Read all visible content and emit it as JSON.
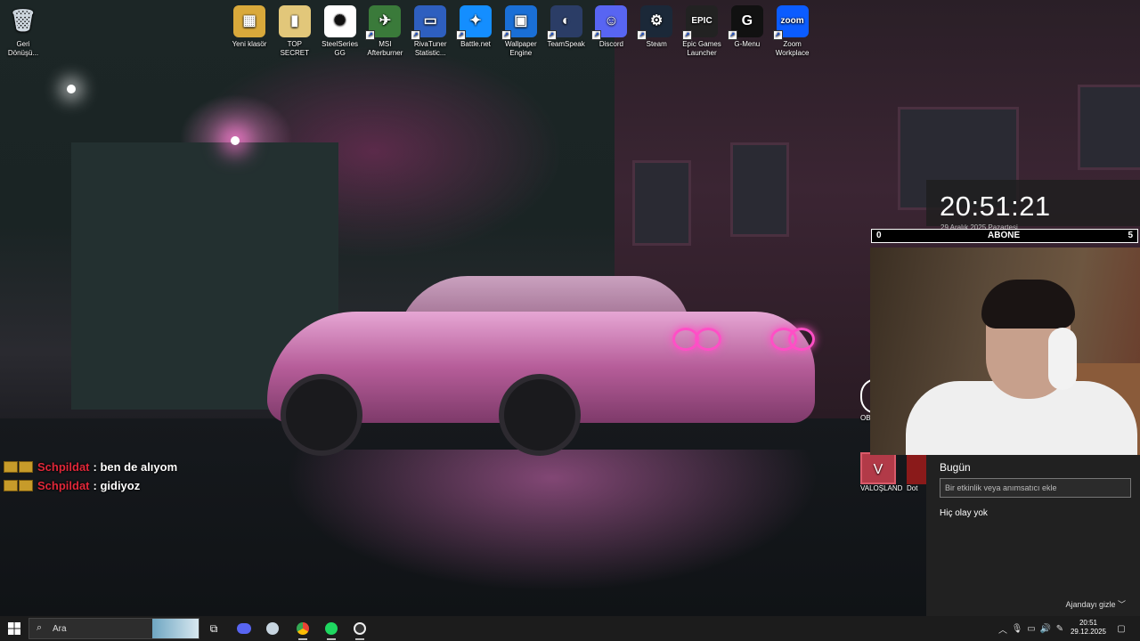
{
  "desktop": {
    "recycle_bin": {
      "label": "Geri\nDönüşü..."
    },
    "icons": [
      {
        "id": "yeni-klasor",
        "label": "Yeni klasör",
        "icon": "folder-zip-icon",
        "color": "#d9a93b",
        "text": "▦"
      },
      {
        "id": "top-secret",
        "label": "TOP SECRET",
        "icon": "folder-icon",
        "color": "#e2c77a",
        "text": "▮"
      },
      {
        "id": "steelseries",
        "label": "SteelSeries GG",
        "icon": "steelseries-icon",
        "color": "#ffffff",
        "text": "✺"
      },
      {
        "id": "msi",
        "label": "MSI Afterburner",
        "icon": "msi-afterburner-icon",
        "color": "#3a7a3a",
        "text": "✈"
      },
      {
        "id": "rivatuner",
        "label": "RivaTuner Statistic...",
        "icon": "rivatuner-icon",
        "color": "#2e5fbf",
        "text": "▭"
      },
      {
        "id": "battlenet",
        "label": "Battle.net",
        "icon": "battlenet-icon",
        "color": "#148eff",
        "text": "✦"
      },
      {
        "id": "wallpaper",
        "label": "Wallpaper Engine",
        "icon": "wallpaper-engine-icon",
        "color": "#1a6fd6",
        "text": "▣"
      },
      {
        "id": "teamspeak",
        "label": "TeamSpeak",
        "icon": "teamspeak-icon",
        "color": "#2b3d66",
        "text": "◐"
      },
      {
        "id": "discord",
        "label": "Discord",
        "icon": "discord-icon",
        "color": "#5865f2",
        "text": "☺"
      },
      {
        "id": "steam",
        "label": "Steam",
        "icon": "steam-icon",
        "color": "#1b2838",
        "text": "⚙"
      },
      {
        "id": "epic",
        "label": "Epic Games Launcher",
        "icon": "epic-games-icon",
        "color": "#222222",
        "text": "EPIC"
      },
      {
        "id": "gmenu",
        "label": "G-Menu",
        "icon": "g-menu-icon",
        "color": "#111111",
        "text": "G"
      },
      {
        "id": "zoom",
        "label": "Zoom Workplace",
        "icon": "zoom-icon",
        "color": "#0b5cff",
        "text": "zoom"
      }
    ],
    "partial_icons": {
      "obs": "OB",
      "valo": "VALOŞLAND",
      "dota": "Dot"
    }
  },
  "clock_widget": {
    "time": "20:51:21",
    "date": "29 Aralık 2025 Pazartesi",
    "abone_label": "ABONE",
    "abone_left": "0",
    "abone_right": "5"
  },
  "calendar": {
    "today": "Bugün",
    "event_placeholder": "Bir etkinlik veya anımsatıcı ekle",
    "no_events": "Hiç olay yok",
    "hide_agenda": "Ajandayı gizle ﹀"
  },
  "chat": [
    {
      "user": "Schpildat",
      "message": ": ben de alıyom"
    },
    {
      "user": "Schpildat",
      "message": ": gidiyoz"
    }
  ],
  "taskbar": {
    "search_placeholder": "Ara",
    "time": "20:51",
    "date": "29.12.2025",
    "apps": [
      "task-view-icon",
      "discord-icon",
      "steam-icon",
      "chrome-icon",
      "spotify-icon",
      "obs-icon"
    ]
  }
}
